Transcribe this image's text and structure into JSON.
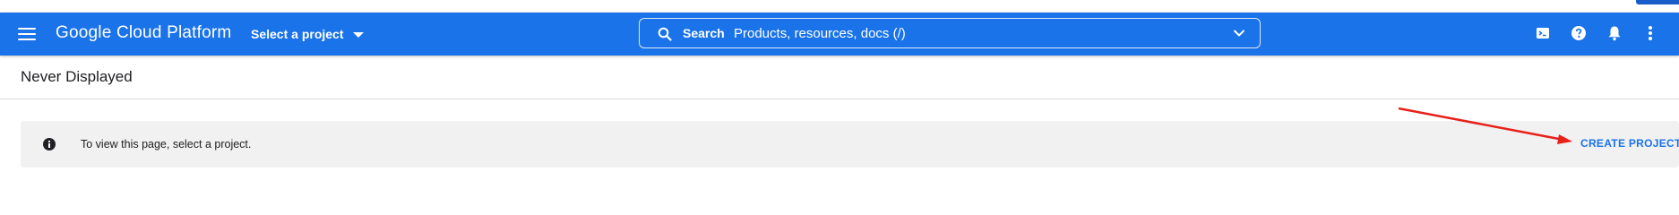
{
  "app": {
    "brand": "Google Cloud Platform",
    "project_selector": "Select a project"
  },
  "search": {
    "label": "Search",
    "placeholder": "Products, resources, docs (/)"
  },
  "toolbar_icons": [
    "cloud-shell-icon",
    "help-icon",
    "notifications-icon",
    "more-vert-icon"
  ],
  "page": {
    "title": "Never Displayed"
  },
  "banner": {
    "message": "To view this page, select a project.",
    "action": "CREATE PROJECT"
  },
  "colors": {
    "app_bar": "#1a73e8",
    "banner_bg": "#f1f1f1",
    "link": "#1a73e8",
    "annotation": "#e8201a"
  }
}
